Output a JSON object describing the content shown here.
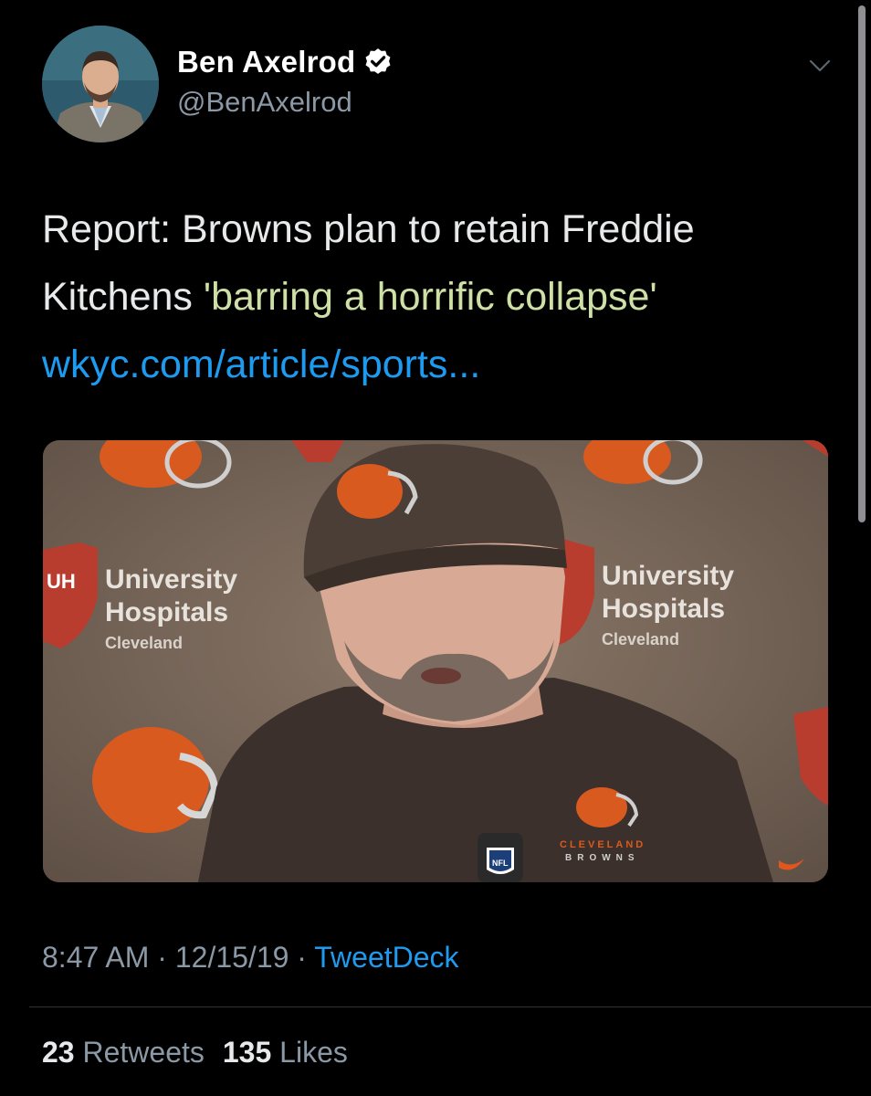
{
  "author": {
    "name": "Ben Axelrod",
    "handle": "@BenAxelrod",
    "verified": true
  },
  "tweet": {
    "line1": "Report: Browns plan to retain Freddie",
    "line2_plain": "Kitchens ",
    "line2_highlight": "'barring a horrific collapse'",
    "link": "wkyc.com/article/sports..."
  },
  "media": {
    "sign_line1": "University",
    "sign_line2": "Hospitals",
    "sign_line3": "Cleveland",
    "sign_short": "UH",
    "shirt_line1": "CLEVELAND",
    "shirt_line2": "BROWNS",
    "mic_label": "NFL"
  },
  "meta": {
    "time": "8:47 AM",
    "sep1": " · ",
    "date": "12/15/19",
    "sep2": " · ",
    "source": "TweetDeck"
  },
  "stats": {
    "retweets_count": "23",
    "retweets_label": "Retweets",
    "likes_count": "135",
    "likes_label": "Likes"
  },
  "colors": {
    "background": "#000000",
    "link": "#1d9bf0",
    "secondary_text": "#8b98a5",
    "highlight": "#78a028",
    "browns_orange": "#e0561f"
  },
  "icons": [
    "verified-badge-icon",
    "chevron-down-icon",
    "scrollbar"
  ]
}
